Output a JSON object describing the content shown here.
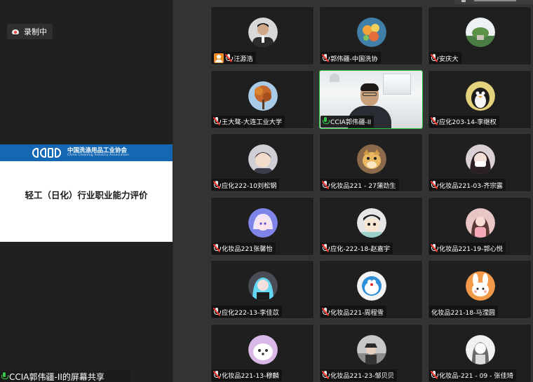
{
  "recording": {
    "label": "录制中"
  },
  "slide": {
    "org_cn": "中国洗涤用品工业协会",
    "org_en": "China Cleaning Industry Association",
    "title": "轻工（日化）行业职业能力评价"
  },
  "presenter": {
    "label": "CCIA郭伟疆-II的屏幕共享"
  },
  "colors": {
    "slide_band": "#1467b3",
    "active_speaker": "#27c43a",
    "mic_muted": "#ff3b30",
    "mic_active": "#35c84a",
    "guest_badge": "#f08a24"
  },
  "participants": [
    {
      "name": "汪源浩",
      "mic": "muted",
      "guest_icon": true,
      "avatar": "man-suit"
    },
    {
      "name": "郭伟疆-中国洗协",
      "mic": "muted",
      "avatar": "fruit"
    },
    {
      "name": "安庆大",
      "mic": "muted",
      "avatar": "building"
    },
    {
      "name": "王大骜-大连工业大学",
      "mic": "muted",
      "avatar": "autumn-tree"
    },
    {
      "name": "CCIA郭伟疆-II",
      "mic": "active",
      "camera": true
    },
    {
      "name": "应化203-14-李继权",
      "mic": "muted",
      "avatar": "penguin"
    },
    {
      "name": "应化222-10刘松钢",
      "mic": "muted",
      "avatar": "boy"
    },
    {
      "name": "化妆品221 - 27蒲劲生",
      "mic": "muted",
      "avatar": "doge"
    },
    {
      "name": "化妆品221-03-齐宗露",
      "mic": "muted",
      "avatar": "girl-mask"
    },
    {
      "name": "化妆品221张馨怡",
      "mic": "muted",
      "avatar": "anime-blue"
    },
    {
      "name": "应化-222-18-赵嘉宇",
      "mic": "muted",
      "avatar": "cartoon-sticker"
    },
    {
      "name": "化妆品221-19-郭心悦",
      "mic": "muted",
      "avatar": "pink-girl"
    },
    {
      "name": "应化222-13-李佳苡",
      "mic": "muted",
      "avatar": "blue-hair"
    },
    {
      "name": "化妆品221-周程雪",
      "mic": "muted",
      "avatar": "doraemon"
    },
    {
      "name": "化妆品221-18-马滢圆",
      "mic": "none",
      "avatar": "bunny"
    },
    {
      "name": "化妆品221-13-穆麟",
      "mic": "muted",
      "avatar": "white-dog"
    },
    {
      "name": "化妆品221-23-邹贝贝",
      "mic": "muted",
      "avatar": "boy-hat"
    },
    {
      "name": "化妆品-221 - 09 - 张佳琦",
      "mic": "muted",
      "avatar": "girl-sketch"
    }
  ]
}
